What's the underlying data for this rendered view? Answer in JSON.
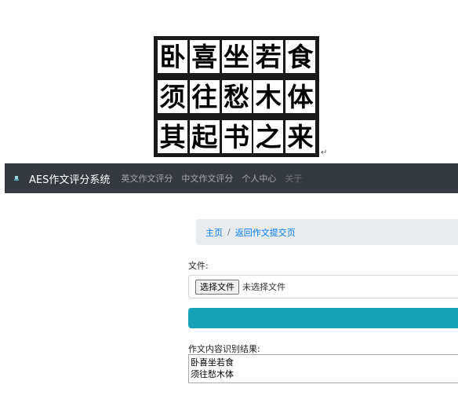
{
  "image": {
    "rows": [
      [
        "卧",
        "喜",
        "坐",
        "若",
        "食"
      ],
      [
        "须",
        "往",
        "愁",
        "木",
        "体"
      ],
      [
        "其",
        "起",
        "书",
        "之",
        "来"
      ]
    ],
    "trailing_mark": "↵"
  },
  "navbar": {
    "brand": "AES作文评分系统",
    "links": [
      "英文作文评分",
      "中文作文评分",
      "个人中心",
      "关于"
    ],
    "brand_icon": "logo-icon",
    "background": "#343a40"
  },
  "breadcrumb": {
    "home": "主页",
    "separator": "/",
    "current": "返回作文提交页"
  },
  "form": {
    "file_label": "文件:",
    "file_button": "选择文件",
    "file_status": "未选择文件",
    "submit_color": "#17a2b8"
  },
  "result": {
    "label": "作文内容识别结果:",
    "lines": [
      "卧喜坐若食",
      "须往愁木体"
    ]
  }
}
